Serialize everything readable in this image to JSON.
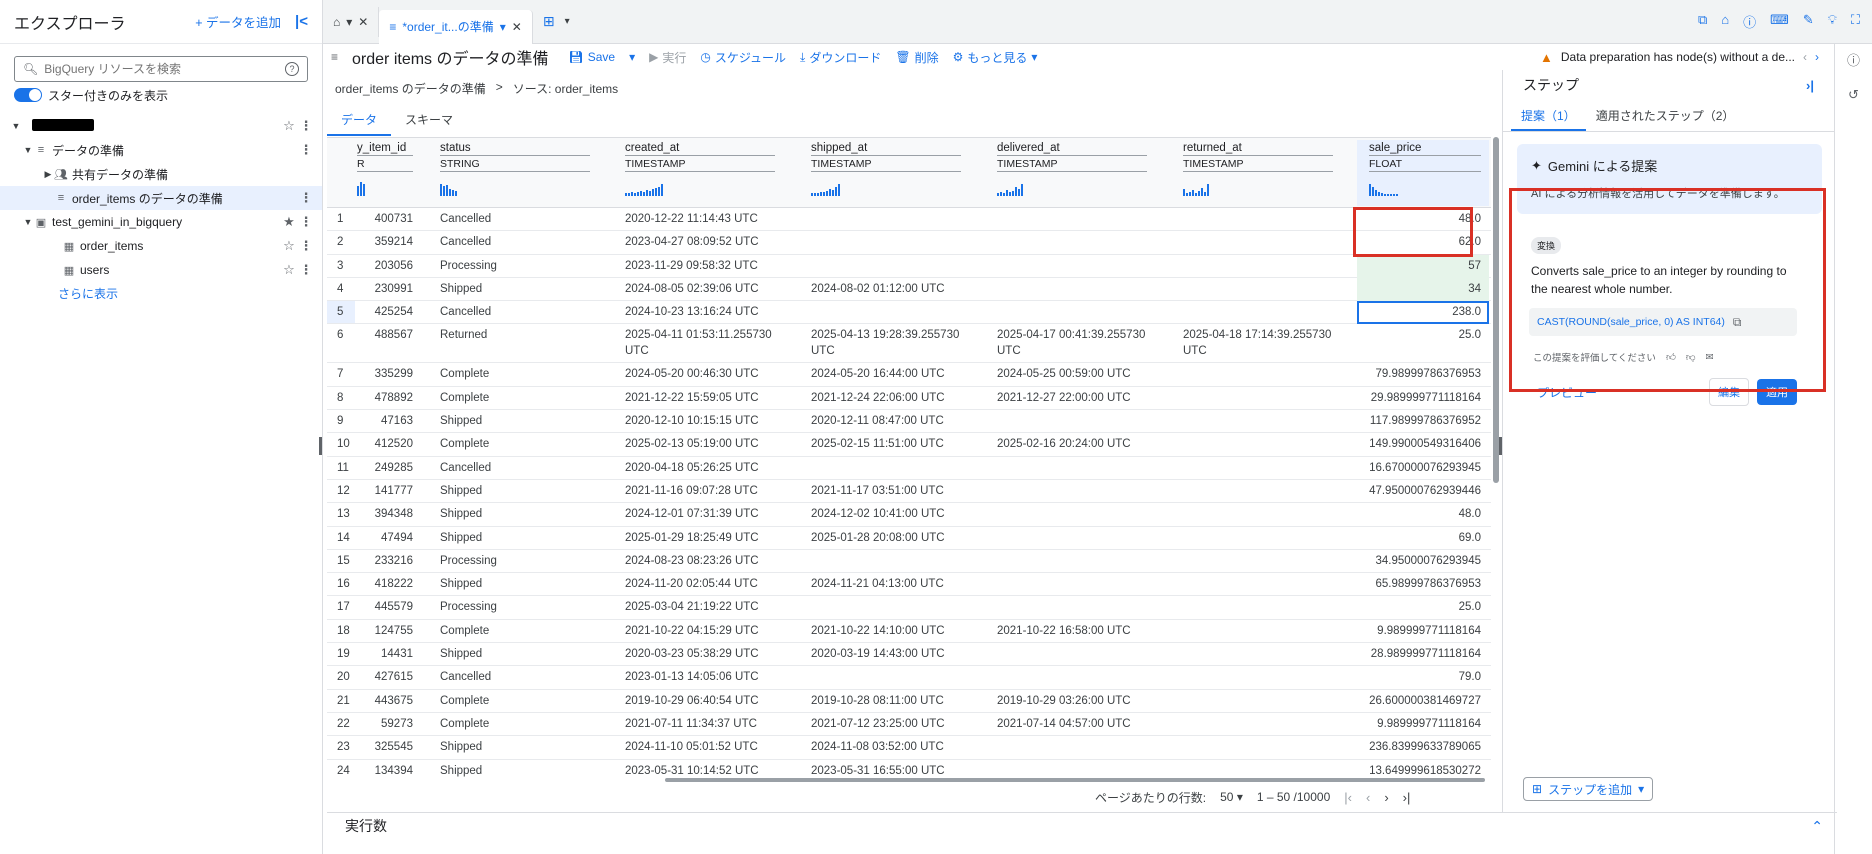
{
  "sidebar": {
    "title": "エクスプローラ",
    "add_data": "+ データを追加",
    "collapse_icon": "|<",
    "search_placeholder": "BigQuery リソースを検索",
    "starred_only": "スター付きのみを表示",
    "tree": [
      {
        "label": "",
        "redacted": true
      },
      {
        "label": "データの準備"
      },
      {
        "label": "共有データの準備"
      },
      {
        "label": "order_items のデータの準備"
      },
      {
        "label": "test_gemini_in_bigquery"
      },
      {
        "label": "order_items"
      },
      {
        "label": "users"
      }
    ],
    "show_more": "さらに表示"
  },
  "tabs": {
    "home_x": "✕",
    "active_label": "*order_it...の準備",
    "active_x": "✕"
  },
  "toolbar": {
    "title": "order items のデータの準備",
    "save": "Save",
    "run": "実行",
    "schedule": "スケジュール",
    "download": "ダウンロード",
    "delete": "削除",
    "more": "もっと見る",
    "warning": "Data preparation has node(s) without a de..."
  },
  "breadcrumb": {
    "item1": "order_items のデータの準備",
    "sep": ">",
    "item2": "ソース: order_items"
  },
  "subtabs": {
    "data": "データ",
    "schema": "スキーマ"
  },
  "columns": [
    {
      "name": "y_item_id",
      "type": "R"
    },
    {
      "name": "status",
      "type": "STRING"
    },
    {
      "name": "created_at",
      "type": "TIMESTAMP"
    },
    {
      "name": "shipped_at",
      "type": "TIMESTAMP"
    },
    {
      "name": "delivered_at",
      "type": "TIMESTAMP"
    },
    {
      "name": "returned_at",
      "type": "TIMESTAMP"
    },
    {
      "name": "sale_price",
      "type": "FLOAT"
    }
  ],
  "rows": [
    {
      "n": "1",
      "id": "400731",
      "st": "Cancelled",
      "ca": "2020-12-22 11:14:43 UTC",
      "sh": "",
      "de": "",
      "re": "",
      "sp": "48.0"
    },
    {
      "n": "2",
      "id": "359214",
      "st": "Cancelled",
      "ca": "2023-04-27 08:09:52 UTC",
      "sh": "",
      "de": "",
      "re": "",
      "sp": "62.0"
    },
    {
      "n": "3",
      "id": "203056",
      "st": "Processing",
      "ca": "2023-11-29 09:58:32 UTC",
      "sh": "",
      "de": "",
      "re": "",
      "sp": "57"
    },
    {
      "n": "4",
      "id": "230991",
      "st": "Shipped",
      "ca": "2024-08-05 02:39:06 UTC",
      "sh": "2024-08-02 01:12:00 UTC",
      "de": "",
      "re": "",
      "sp": "34"
    },
    {
      "n": "5",
      "id": "425254",
      "st": "Cancelled",
      "ca": "2024-10-23 13:16:24 UTC",
      "sh": "",
      "de": "",
      "re": "",
      "sp": "238.0"
    },
    {
      "n": "6",
      "id": "488567",
      "st": "Returned",
      "ca": "2025-04-11 01:53:11.255730 UTC",
      "sh": "2025-04-13 19:28:39.255730 UTC",
      "de": "2025-04-17 00:41:39.255730 UTC",
      "re": "2025-04-18 17:14:39.255730 UTC",
      "sp": "25.0"
    },
    {
      "n": "7",
      "id": "335299",
      "st": "Complete",
      "ca": "2024-05-20 00:46:30 UTC",
      "sh": "2024-05-20 16:44:00 UTC",
      "de": "2024-05-25 00:59:00 UTC",
      "re": "",
      "sp": "79.98999786376953"
    },
    {
      "n": "8",
      "id": "478892",
      "st": "Complete",
      "ca": "2021-12-22 15:59:05 UTC",
      "sh": "2021-12-24 22:06:00 UTC",
      "de": "2021-12-27 22:00:00 UTC",
      "re": "",
      "sp": "29.989999771118164"
    },
    {
      "n": "9",
      "id": "47163",
      "st": "Shipped",
      "ca": "2020-12-10 10:15:15 UTC",
      "sh": "2020-12-11 08:47:00 UTC",
      "de": "",
      "re": "",
      "sp": "117.98999786376952"
    },
    {
      "n": "10",
      "id": "412520",
      "st": "Complete",
      "ca": "2025-02-13 05:19:00 UTC",
      "sh": "2025-02-15 11:51:00 UTC",
      "de": "2025-02-16 20:24:00 UTC",
      "re": "",
      "sp": "149.99000549316406"
    },
    {
      "n": "11",
      "id": "249285",
      "st": "Cancelled",
      "ca": "2020-04-18 05:26:25 UTC",
      "sh": "",
      "de": "",
      "re": "",
      "sp": "16.670000076293945"
    },
    {
      "n": "12",
      "id": "141777",
      "st": "Shipped",
      "ca": "2021-11-16 09:07:28 UTC",
      "sh": "2021-11-17 03:51:00 UTC",
      "de": "",
      "re": "",
      "sp": "47.950000762939446"
    },
    {
      "n": "13",
      "id": "394348",
      "st": "Shipped",
      "ca": "2024-12-01 07:31:39 UTC",
      "sh": "2024-12-02 10:41:00 UTC",
      "de": "",
      "re": "",
      "sp": "48.0"
    },
    {
      "n": "14",
      "id": "47494",
      "st": "Shipped",
      "ca": "2025-01-29 18:25:49 UTC",
      "sh": "2025-01-28 20:08:00 UTC",
      "de": "",
      "re": "",
      "sp": "69.0"
    },
    {
      "n": "15",
      "id": "233216",
      "st": "Processing",
      "ca": "2024-08-23 08:23:26 UTC",
      "sh": "",
      "de": "",
      "re": "",
      "sp": "34.95000076293945"
    },
    {
      "n": "16",
      "id": "418222",
      "st": "Shipped",
      "ca": "2024-11-20 02:05:44 UTC",
      "sh": "2024-11-21 04:13:00 UTC",
      "de": "",
      "re": "",
      "sp": "65.98999786376953"
    },
    {
      "n": "17",
      "id": "445579",
      "st": "Processing",
      "ca": "2025-03-04 21:19:22 UTC",
      "sh": "",
      "de": "",
      "re": "",
      "sp": "25.0"
    },
    {
      "n": "18",
      "id": "124755",
      "st": "Complete",
      "ca": "2021-10-22 04:15:29 UTC",
      "sh": "2021-10-22 14:10:00 UTC",
      "de": "2021-10-22 16:58:00 UTC",
      "re": "",
      "sp": "9.989999771118164"
    },
    {
      "n": "19",
      "id": "14431",
      "st": "Shipped",
      "ca": "2020-03-23 05:38:29 UTC",
      "sh": "2020-03-19 14:43:00 UTC",
      "de": "",
      "re": "",
      "sp": "28.989999771118164"
    },
    {
      "n": "20",
      "id": "427615",
      "st": "Cancelled",
      "ca": "2023-01-13 14:05:06 UTC",
      "sh": "",
      "de": "",
      "re": "",
      "sp": "79.0"
    },
    {
      "n": "21",
      "id": "443675",
      "st": "Complete",
      "ca": "2019-10-29 06:40:54 UTC",
      "sh": "2019-10-28 08:11:00 UTC",
      "de": "2019-10-29 03:26:00 UTC",
      "re": "",
      "sp": "26.600000381469727"
    },
    {
      "n": "22",
      "id": "59273",
      "st": "Complete",
      "ca": "2021-07-11 11:34:37 UTC",
      "sh": "2021-07-12 23:25:00 UTC",
      "de": "2021-07-14 04:57:00 UTC",
      "re": "",
      "sp": "9.989999771118164"
    },
    {
      "n": "23",
      "id": "325545",
      "st": "Shipped",
      "ca": "2024-11-10 05:01:52 UTC",
      "sh": "2024-11-08 03:52:00 UTC",
      "de": "",
      "re": "",
      "sp": "236.83999633789065"
    },
    {
      "n": "24",
      "id": "134394",
      "st": "Shipped",
      "ca": "2023-05-31 10:14:52 UTC",
      "sh": "2023-05-31 16:55:00 UTC",
      "de": "",
      "re": "",
      "sp": "13.649999618530272"
    }
  ],
  "pager": {
    "rows_per_page_label": "ページあたりの行数:",
    "rows_per_page": "50",
    "range": "1 – 50 /10000"
  },
  "exec_count": "実行数",
  "steps": {
    "title": "ステップ",
    "tab_suggestions": "提案（1）",
    "tab_applied": "適用されたステップ（2）",
    "gemini_title": "Gemini による提案",
    "gemini_desc": "AI による分析情報を活用してデータを準備します。",
    "chip": "変換",
    "suggestion_text": "Converts sale_price to an integer by rounding to the nearest whole number.",
    "code": "CAST(ROUND(sale_price, 0) AS INT64)",
    "rate_prompt": "この提案を評価してください",
    "preview": "プレビュー",
    "edit": "編集",
    "apply": "適用",
    "add_step": "ステップを追加"
  },
  "colors": {
    "accent": "#1a73e8",
    "highlight": "#d93025",
    "changed_cell": "#e6f4ea"
  }
}
